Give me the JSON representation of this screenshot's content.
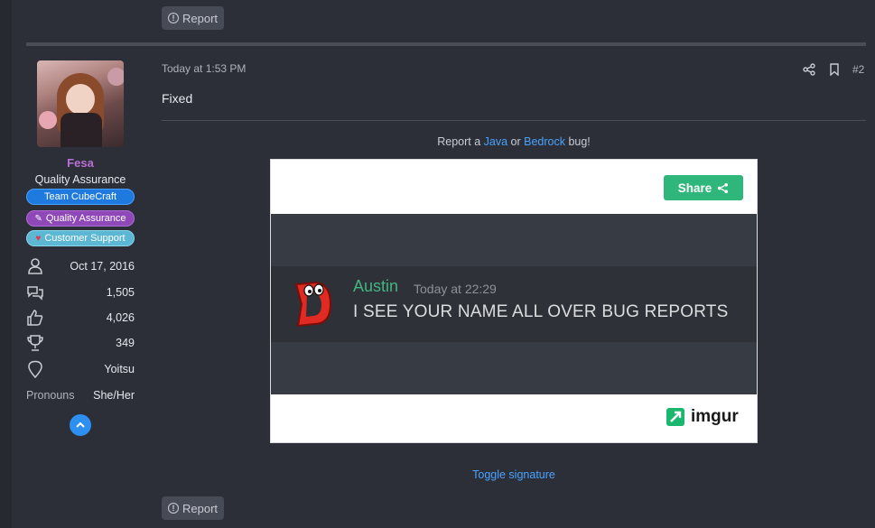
{
  "top_report": {
    "label": "Report"
  },
  "bottom_report": {
    "label": "Report"
  },
  "user": {
    "name": "Fesa",
    "title": "Quality Assurance",
    "banners": [
      {
        "label": "Team CubeCraft",
        "icon": ""
      },
      {
        "label": "Quality Assurance",
        "icon": "pencil-icon"
      },
      {
        "label": "Customer Support",
        "icon": "heart-icon"
      }
    ],
    "stats": [
      {
        "icon": "user-icon",
        "value": "Oct 17, 2016"
      },
      {
        "icon": "messages-icon",
        "value": "1,505"
      },
      {
        "icon": "thumbs-up-icon",
        "value": "4,026"
      },
      {
        "icon": "trophy-icon",
        "value": "349"
      },
      {
        "icon": "location-icon",
        "value": "Yoitsu"
      }
    ],
    "pronouns": {
      "label": "Pronouns",
      "value": "She/Her"
    }
  },
  "post": {
    "time": "Today at 1:53 PM",
    "number": "#2",
    "body": "Fixed"
  },
  "signature": {
    "prefix": "Report a ",
    "java": "Java",
    "middle": " or ",
    "bedrock": "Bedrock",
    "suffix": " bug!",
    "embed": {
      "share_label": "Share",
      "author": "Austin",
      "timestamp": "Today at 22:29",
      "message": "I SEE YOUR NAME ALL OVER BUG REPORTS",
      "brand": "imgur"
    },
    "toggle": "Toggle signature"
  },
  "colors": {
    "background": "#2c2f38",
    "username": "#b86fd6",
    "link": "#4aa3ff",
    "share_green": "#2fb67a",
    "discord_author": "#43b581"
  }
}
